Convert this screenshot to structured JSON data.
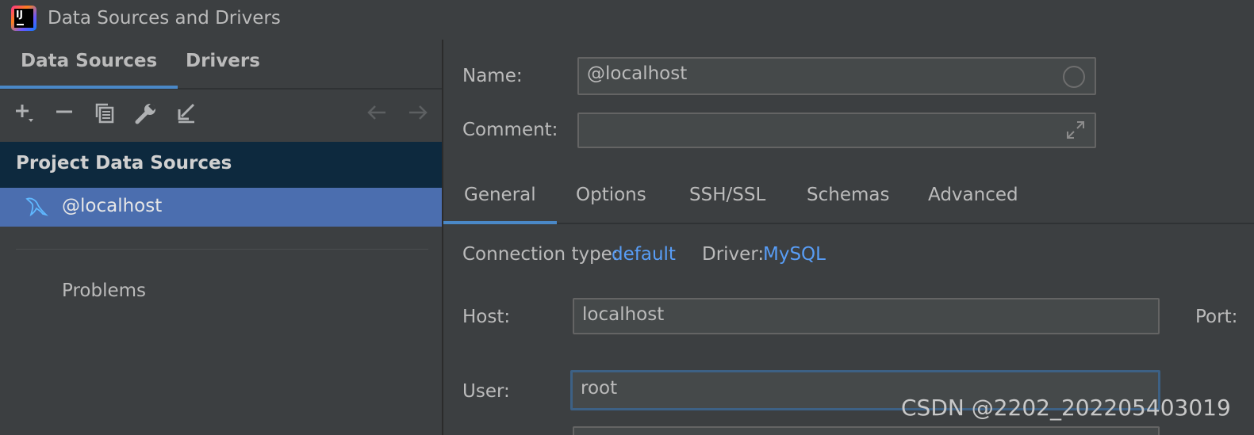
{
  "window": {
    "title": "Data Sources and Drivers"
  },
  "left_tabs": [
    {
      "label": "Data Sources",
      "active": true
    },
    {
      "label": "Drivers",
      "active": false
    }
  ],
  "toolbar": {
    "add_icon": "plus-dropdown-icon",
    "remove_icon": "minus-icon",
    "copy_icon": "copy-icon",
    "settings_icon": "wrench-icon",
    "import_icon": "import-icon",
    "back_icon": "arrow-left-icon",
    "forward_icon": "arrow-right-icon"
  },
  "tree": {
    "group_title": "Project Data Sources",
    "selected_item": {
      "label": "@localhost",
      "icon": "mysql-dolphin-icon"
    },
    "problems_label": "Problems"
  },
  "form": {
    "name_label": "Name:",
    "name_value": "@localhost",
    "comment_label": "Comment:",
    "comment_value": ""
  },
  "config_tabs": [
    {
      "label": "General",
      "active": true
    },
    {
      "label": "Options",
      "active": false
    },
    {
      "label": "SSH/SSL",
      "active": false
    },
    {
      "label": "Schemas",
      "active": false
    },
    {
      "label": "Advanced",
      "active": false
    }
  ],
  "general": {
    "connection_type_label": "Connection type:",
    "connection_type_value": "default",
    "driver_label": "Driver:",
    "driver_value": "MySQL",
    "host_label": "Host:",
    "host_value": "localhost",
    "port_label": "Port:",
    "user_label": "User:",
    "user_value": "root"
  },
  "watermark": "CSDN @2202_202205403019",
  "colors": {
    "background": "#3c3f41",
    "selection": "#4b6eaf",
    "group_header": "#0d293e",
    "accent_tab": "#4a88c7",
    "link": "#589df6"
  }
}
